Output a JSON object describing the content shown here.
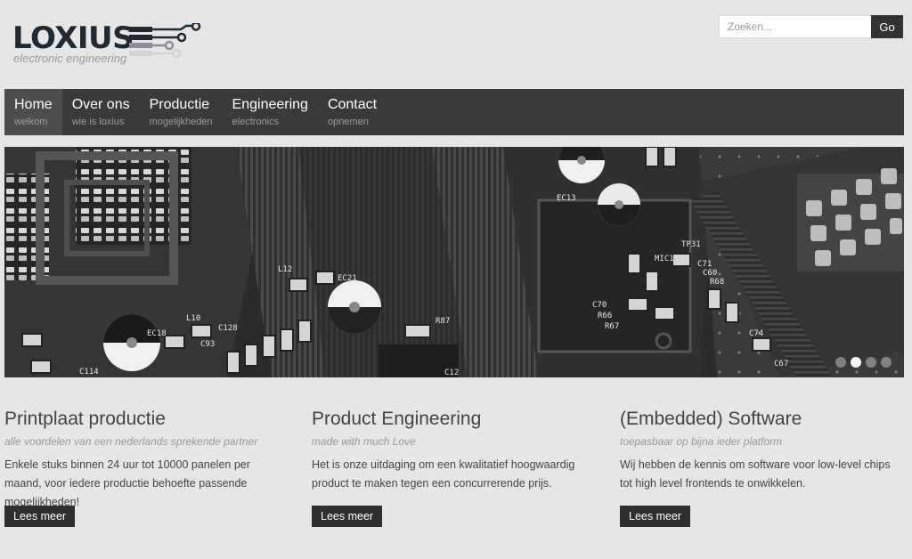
{
  "brand": {
    "name": "LOXIUS",
    "tagline": "electronic engineering",
    "colors": {
      "dark": "#1f2a33",
      "grey": "#9a9a9a"
    }
  },
  "search": {
    "placeholder": "Zoeken...",
    "button_label": "Go"
  },
  "nav": {
    "items": [
      {
        "title": "Home",
        "subtitle": "welkom"
      },
      {
        "title": "Over ons",
        "subtitle": "wie is loxius"
      },
      {
        "title": "Productie",
        "subtitle": "mogelijkheden"
      },
      {
        "title": "Engineering",
        "subtitle": "electronics"
      },
      {
        "title": "Contact",
        "subtitle": "opnemen"
      }
    ],
    "active_index": 0
  },
  "banner": {
    "image": "circuit-board-photo",
    "slide_count": 4,
    "active_slide": 2,
    "silkscreen": {
      "l12": "L12",
      "ec21": "EC21",
      "ec18": "EC18",
      "l10": "L10",
      "c93": "C93",
      "c128": "C128",
      "r87": "R87",
      "c114": "C114",
      "c70": "C70",
      "r66": "R66",
      "r67": "R67",
      "c71": "C71",
      "c60": "C60",
      "r68": "R68",
      "c74": "C74",
      "c67": "C67",
      "ec13": "EC13",
      "tp31": "TP31",
      "mic1": "MIC1",
      "c12": "C12"
    }
  },
  "columns": [
    {
      "title": "Printplaat productie",
      "subtitle": "alle voordelen van een nederlands sprekende partner",
      "text": "Enkele stuks binnen 24 uur tot 10000 panelen per maand, voor iedere productie behoefte passende mogelijkheden!",
      "button": "Lees meer"
    },
    {
      "title": "Product Engineering",
      "subtitle": "made with much Love",
      "text": "Het is onze uitdaging om een kwalitatief hoogwaardig product te maken tegen een concurrerende prijs.",
      "button": "Lees meer"
    },
    {
      "title": "(Embedded) Software",
      "subtitle": "toepasbaar op bijna ieder platform",
      "text": "Wij hebben de kennis om software voor low-level chips tot high level frontends te onwikkelen.",
      "button": "Lees meer"
    }
  ],
  "colors": {
    "background": "#e6e6e6",
    "nav_bg": "#3a3a3a",
    "nav_active": "#4d4d4d",
    "button_bg": "#2f2f2f"
  }
}
